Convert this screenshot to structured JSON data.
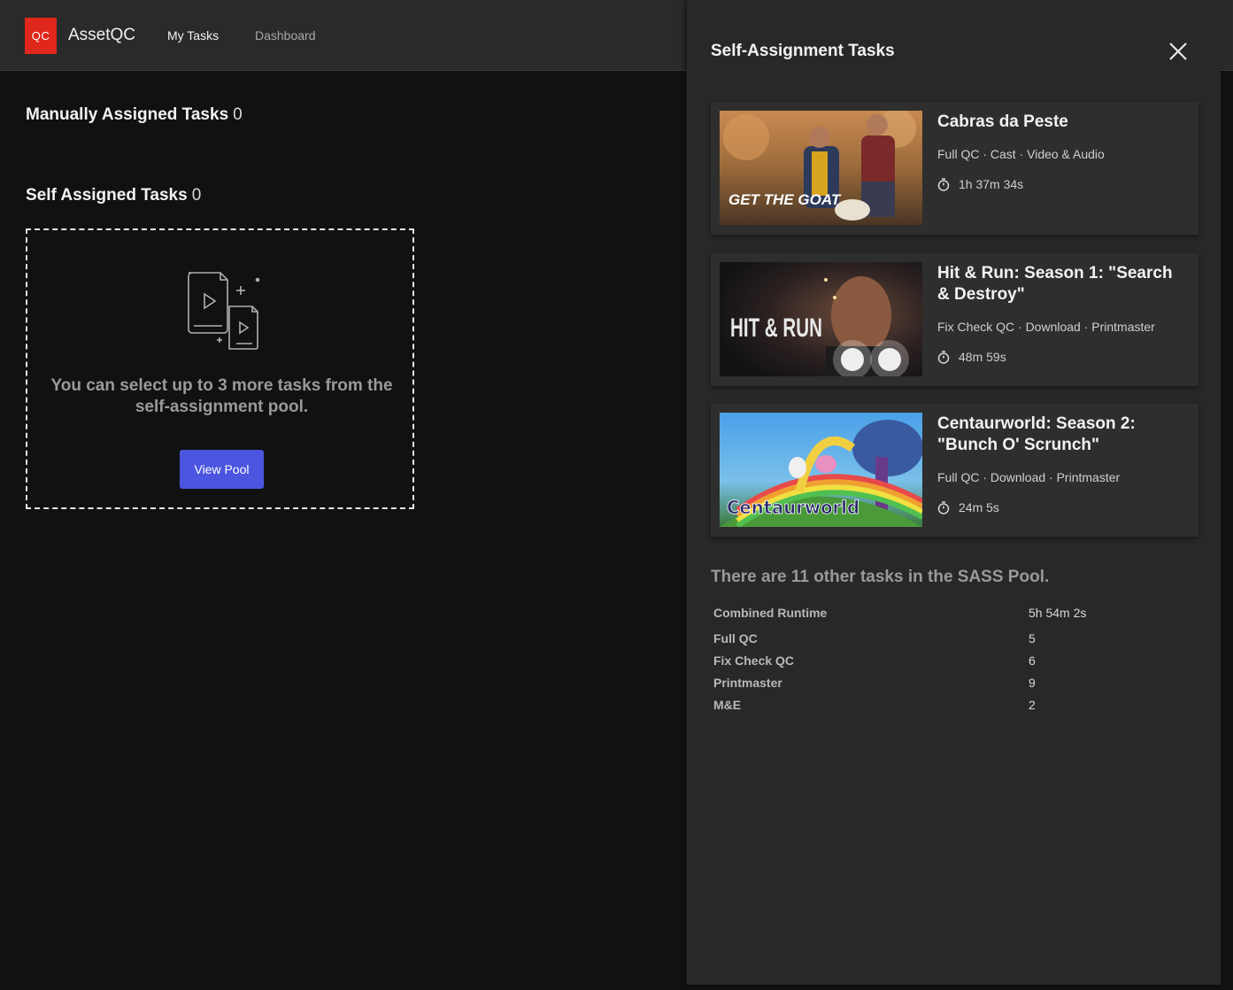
{
  "app": {
    "logo_text": "QC",
    "name": "AssetQC"
  },
  "nav": {
    "items": [
      {
        "label": "My Tasks"
      },
      {
        "label": "Dashboard"
      }
    ]
  },
  "main": {
    "manual": {
      "label": "Manually Assigned Tasks",
      "count": "0"
    },
    "self": {
      "label": "Self Assigned Tasks",
      "count": "0"
    },
    "empty_state": {
      "message": "You can select up to 3 more tasks from the self-assignment pool.",
      "button_label": "View Pool"
    }
  },
  "panel": {
    "title": "Self-Assignment Tasks",
    "tasks": [
      {
        "title": "Cabras da Peste",
        "meta": "Full QC · Cast · Video & Audio",
        "runtime": "1h 37m 34s",
        "thumb_caption": "GET THE GOAT"
      },
      {
        "title": "Hit & Run: Season 1: \"Search & Destroy\"",
        "meta": "Fix Check QC · Download · Printmaster",
        "runtime": "48m 59s",
        "thumb_caption": "HIT & RUN"
      },
      {
        "title": "Centaurworld: Season 2: \"Bunch O' Scrunch\"",
        "meta": "Full QC · Download · Printmaster",
        "runtime": "24m 5s",
        "thumb_caption": "Centaurworld"
      }
    ],
    "pool_summary": "There are 11 other tasks in the SASS Pool.",
    "stats": [
      {
        "label": "Combined Runtime",
        "value": "5h 54m 2s"
      },
      {
        "label": "Full QC",
        "value": "5"
      },
      {
        "label": "Fix Check QC",
        "value": "6"
      },
      {
        "label": "Printmaster",
        "value": "9"
      },
      {
        "label": "M&E",
        "value": "2"
      }
    ]
  },
  "colors": {
    "accent_logo": "#e0271b",
    "primary_button": "#4b55df",
    "panel_bg": "#282828",
    "page_bg": "#111111"
  },
  "icons": {
    "close": "close-icon",
    "timer": "stopwatch-icon",
    "empty": "video-files-icon"
  }
}
